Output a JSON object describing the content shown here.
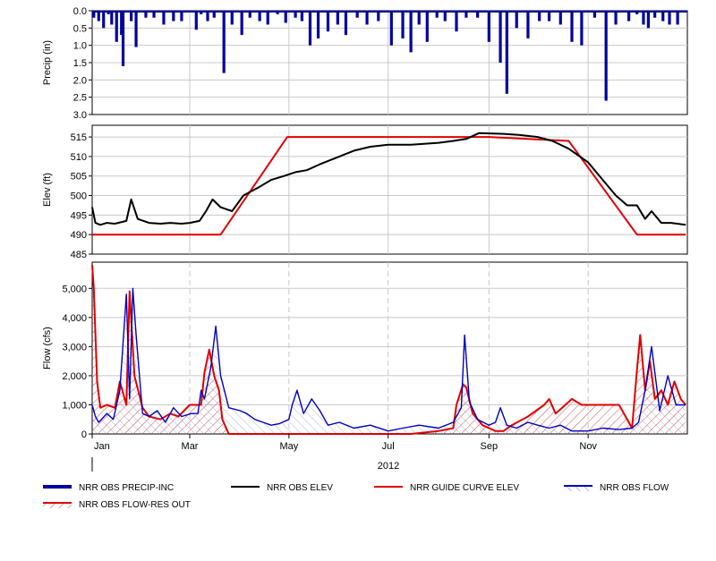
{
  "chart_data": [
    {
      "type": "bar",
      "name": "precip-panel",
      "ylabel": "Precip (in)",
      "ylim": [
        0,
        3.0
      ],
      "y_inverted": true,
      "yticks": [
        "0.0",
        "0.5",
        "1.0",
        "1.5",
        "2.0",
        "2.5",
        "3.0"
      ],
      "grid": true,
      "series": [
        {
          "name": "NRR OBS PRECIP-INC",
          "color": "#0000a0",
          "x": [
            "2012-01-02",
            "2012-01-05",
            "2012-01-08",
            "2012-01-11",
            "2012-01-13",
            "2012-01-16",
            "2012-01-19",
            "2012-01-20",
            "2012-01-25",
            "2012-01-28",
            "2012-02-03",
            "2012-02-08",
            "2012-02-14",
            "2012-02-20",
            "2012-02-25",
            "2012-03-05",
            "2012-03-08",
            "2012-03-12",
            "2012-03-16",
            "2012-03-22",
            "2012-03-27",
            "2012-04-02",
            "2012-04-07",
            "2012-04-13",
            "2012-04-18",
            "2012-04-24",
            "2012-04-29",
            "2012-05-05",
            "2012-05-09",
            "2012-05-14",
            "2012-05-19",
            "2012-05-25",
            "2012-05-31",
            "2012-06-05",
            "2012-06-12",
            "2012-06-18",
            "2012-06-25",
            "2012-07-03",
            "2012-07-10",
            "2012-07-15",
            "2012-07-20",
            "2012-07-25",
            "2012-07-31",
            "2012-08-05",
            "2012-08-12",
            "2012-08-18",
            "2012-08-25",
            "2012-09-01",
            "2012-09-08",
            "2012-09-12",
            "2012-09-18",
            "2012-09-25",
            "2012-10-02",
            "2012-10-08",
            "2012-10-15",
            "2012-10-22",
            "2012-10-28",
            "2012-11-05",
            "2012-11-12",
            "2012-11-18",
            "2012-11-26",
            "2012-12-01",
            "2012-12-05",
            "2012-12-08",
            "2012-12-12",
            "2012-12-17",
            "2012-12-21",
            "2012-12-26"
          ],
          "values": [
            0.2,
            0.3,
            0.5,
            0.1,
            0.4,
            0.9,
            0.7,
            1.6,
            0.3,
            1.05,
            0.2,
            0.2,
            0.4,
            0.3,
            0.3,
            0.55,
            0.1,
            0.3,
            0.2,
            1.8,
            0.4,
            0.7,
            0.2,
            0.3,
            0.4,
            0.1,
            0.35,
            0.2,
            0.3,
            1.0,
            0.8,
            0.6,
            0.4,
            0.7,
            0.2,
            0.4,
            0.3,
            1.0,
            0.8,
            1.2,
            0.4,
            0.9,
            0.2,
            0.3,
            0.6,
            0.2,
            0.2,
            0.9,
            1.5,
            2.4,
            0.5,
            0.8,
            0.3,
            0.3,
            0.4,
            0.9,
            1.0,
            0.2,
            2.6,
            0.4,
            0.3,
            0.1,
            0.4,
            0.5,
            0.2,
            0.3,
            0.4,
            0.4
          ]
        }
      ]
    },
    {
      "type": "line",
      "name": "elev-panel",
      "ylabel": "Elev (ft)",
      "ylim": [
        485,
        518
      ],
      "yticks": [
        "485",
        "490",
        "495",
        "500",
        "505",
        "510",
        "515"
      ],
      "grid": true,
      "series": [
        {
          "name": "NRR OBS ELEV",
          "color": "#000000",
          "x": [
            "2012-01-01",
            "2012-01-03",
            "2012-01-06",
            "2012-01-10",
            "2012-01-15",
            "2012-01-22",
            "2012-01-25",
            "2012-01-29",
            "2012-02-05",
            "2012-02-12",
            "2012-02-18",
            "2012-02-25",
            "2012-03-01",
            "2012-03-07",
            "2012-03-11",
            "2012-03-15",
            "2012-03-20",
            "2012-03-27",
            "2012-04-03",
            "2012-04-12",
            "2012-04-20",
            "2012-04-28",
            "2012-05-05",
            "2012-05-12",
            "2012-05-20",
            "2012-06-01",
            "2012-06-10",
            "2012-06-20",
            "2012-07-01",
            "2012-07-15",
            "2012-08-01",
            "2012-08-10",
            "2012-08-18",
            "2012-08-26",
            "2012-09-10",
            "2012-09-20",
            "2012-10-01",
            "2012-10-10",
            "2012-10-20",
            "2012-11-01",
            "2012-11-10",
            "2012-11-18",
            "2012-11-25",
            "2012-12-01",
            "2012-12-06",
            "2012-12-10",
            "2012-12-16",
            "2012-12-22",
            "2012-12-31"
          ],
          "values": [
            497,
            493,
            492.5,
            493,
            492.8,
            493.5,
            499,
            494,
            493,
            492.8,
            493,
            492.8,
            493,
            493.5,
            496,
            499,
            497,
            496,
            500,
            502,
            504,
            505,
            506,
            506.5,
            508,
            510,
            511.5,
            512.5,
            513,
            513,
            513.5,
            514,
            514.5,
            516,
            515.8,
            515.5,
            515,
            514,
            512,
            508.5,
            504,
            500,
            497.5,
            497.5,
            494,
            496,
            493,
            493,
            492.5
          ]
        },
        {
          "name": "NRR GUIDE CURVE ELEV",
          "color": "#e00000",
          "x": [
            "2012-01-01",
            "2012-03-20",
            "2012-04-30",
            "2012-09-01",
            "2012-10-20",
            "2012-12-01",
            "2012-12-31"
          ],
          "values": [
            490,
            490,
            515,
            515,
            514,
            490,
            490
          ]
        }
      ]
    },
    {
      "type": "area",
      "name": "flow-panel",
      "ylabel": "Flow (cfs)",
      "ylim": [
        0,
        5900
      ],
      "yticks": [
        "0",
        "1,000",
        "2,000",
        "3,000",
        "4,000",
        "5,000"
      ],
      "xticks": [
        "Jan",
        "Mar",
        "May",
        "Jul",
        "Sep",
        "Nov"
      ],
      "xlabel": "2012",
      "grid": true,
      "series": [
        {
          "name": "NRR OBS FLOW",
          "color": "#0000c0",
          "x": [
            "2012-01-01",
            "2012-01-03",
            "2012-01-05",
            "2012-01-10",
            "2012-01-14",
            "2012-01-18",
            "2012-01-22",
            "2012-01-24",
            "2012-01-26",
            "2012-01-28",
            "2012-02-01",
            "2012-02-05",
            "2012-02-10",
            "2012-02-15",
            "2012-02-20",
            "2012-02-25",
            "2012-03-02",
            "2012-03-06",
            "2012-03-08",
            "2012-03-10",
            "2012-03-14",
            "2012-03-17",
            "2012-03-20",
            "2012-03-25",
            "2012-04-01",
            "2012-04-05",
            "2012-04-10",
            "2012-04-15",
            "2012-04-20",
            "2012-04-25",
            "2012-05-01",
            "2012-05-03",
            "2012-05-06",
            "2012-05-10",
            "2012-05-15",
            "2012-05-20",
            "2012-05-25",
            "2012-06-01",
            "2012-06-10",
            "2012-06-20",
            "2012-07-01",
            "2012-07-10",
            "2012-07-20",
            "2012-08-01",
            "2012-08-10",
            "2012-08-15",
            "2012-08-17",
            "2012-08-20",
            "2012-08-25",
            "2012-09-01",
            "2012-09-05",
            "2012-09-08",
            "2012-09-12",
            "2012-09-18",
            "2012-09-25",
            "2012-10-01",
            "2012-10-08",
            "2012-10-15",
            "2012-10-22",
            "2012-11-01",
            "2012-11-10",
            "2012-11-20",
            "2012-11-28",
            "2012-12-02",
            "2012-12-06",
            "2012-12-10",
            "2012-12-15",
            "2012-12-20",
            "2012-12-25",
            "2012-12-31"
          ],
          "values": [
            1000,
            600,
            400,
            700,
            500,
            1500,
            4800,
            1200,
            5000,
            3400,
            700,
            600,
            800,
            400,
            900,
            600,
            700,
            700,
            1500,
            1200,
            2300,
            3700,
            2000,
            900,
            800,
            700,
            500,
            400,
            300,
            350,
            500,
            1000,
            1500,
            700,
            1200,
            800,
            300,
            400,
            200,
            300,
            100,
            200,
            300,
            200,
            400,
            900,
            3400,
            1100,
            500,
            300,
            400,
            900,
            300,
            200,
            400,
            300,
            200,
            300,
            100,
            100,
            200,
            150,
            200,
            400,
            1500,
            3000,
            800,
            2000,
            1000,
            1000
          ]
        },
        {
          "name": "NRR OBS FLOW-RES OUT",
          "color": "#e00000",
          "x": [
            "2012-01-01",
            "2012-01-02",
            "2012-01-04",
            "2012-01-06",
            "2012-01-10",
            "2012-01-15",
            "2012-01-18",
            "2012-01-22",
            "2012-01-24",
            "2012-01-27",
            "2012-02-01",
            "2012-02-05",
            "2012-02-12",
            "2012-02-18",
            "2012-02-23",
            "2012-03-01",
            "2012-03-08",
            "2012-03-10",
            "2012-03-13",
            "2012-03-16",
            "2012-03-19",
            "2012-03-21",
            "2012-03-25",
            "2012-04-20",
            "2012-05-20",
            "2012-06-20",
            "2012-07-15",
            "2012-08-01",
            "2012-08-10",
            "2012-08-12",
            "2012-08-16",
            "2012-08-18",
            "2012-08-22",
            "2012-08-28",
            "2012-09-05",
            "2012-09-10",
            "2012-09-15",
            "2012-09-25",
            "2012-10-05",
            "2012-10-08",
            "2012-10-12",
            "2012-10-18",
            "2012-10-22",
            "2012-10-28",
            "2012-11-10",
            "2012-11-20",
            "2012-11-28",
            "2012-12-01",
            "2012-12-03",
            "2012-12-06",
            "2012-12-09",
            "2012-12-12",
            "2012-12-16",
            "2012-12-20",
            "2012-12-24",
            "2012-12-28",
            "2012-12-31"
          ],
          "values": [
            5800,
            5000,
            1800,
            900,
            1000,
            900,
            1800,
            1000,
            4900,
            2000,
            900,
            600,
            500,
            700,
            600,
            1000,
            1000,
            2100,
            2900,
            2000,
            1500,
            500,
            0,
            0,
            0,
            0,
            0,
            100,
            200,
            1000,
            1700,
            1600,
            700,
            300,
            100,
            100,
            300,
            600,
            1000,
            1200,
            700,
            1000,
            1200,
            1000,
            1000,
            1000,
            200,
            2200,
            3400,
            1500,
            2500,
            1200,
            1500,
            1000,
            1800,
            1200,
            1000
          ]
        }
      ]
    }
  ],
  "legend": [
    {
      "label": "NRR OBS PRECIP-INC",
      "style": "thick-line",
      "color": "#0000a0"
    },
    {
      "label": "NRR OBS ELEV",
      "style": "line",
      "color": "#000000"
    },
    {
      "label": "NRR GUIDE CURVE ELEV",
      "style": "line",
      "color": "#e00000"
    },
    {
      "label": "NRR OBS FLOW",
      "style": "hatched-line",
      "color": "#0000c0"
    },
    {
      "label": "NRR OBS FLOW-RES OUT",
      "style": "hatched-line",
      "color": "#e00000"
    }
  ]
}
